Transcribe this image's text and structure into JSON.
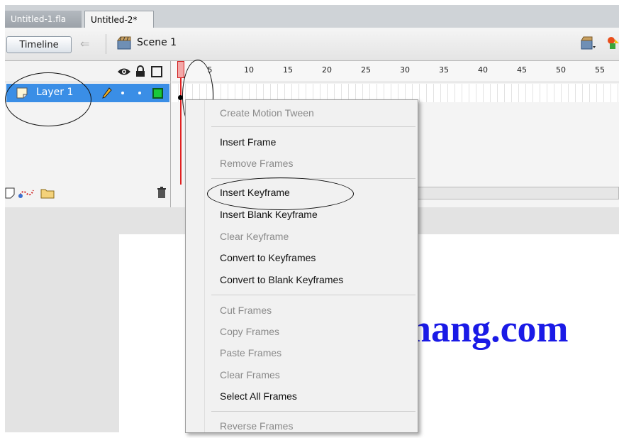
{
  "tabs": [
    {
      "label": "Untitled-1.fla",
      "active": false
    },
    {
      "label": "Untitled-2*",
      "active": true
    }
  ],
  "editbar": {
    "timeline_label": "Timeline",
    "scene_label": "Scene 1"
  },
  "layers": [
    {
      "name": "Layer 1",
      "selected": true
    }
  ],
  "ruler": {
    "ticks": [
      "5",
      "10",
      "15",
      "20",
      "25",
      "30",
      "35",
      "40",
      "45",
      "50",
      "55"
    ]
  },
  "context_menu": {
    "items": [
      {
        "label": "Create Motion Tween",
        "enabled": false
      },
      {
        "label": "Insert Frame",
        "enabled": true
      },
      {
        "label": "Remove Frames",
        "enabled": false
      },
      {
        "label": "Insert Keyframe",
        "enabled": true
      },
      {
        "label": "Insert Blank Keyframe",
        "enabled": true
      },
      {
        "label": "Clear Keyframe",
        "enabled": false
      },
      {
        "label": "Convert to Keyframes",
        "enabled": true
      },
      {
        "label": "Convert to Blank Keyframes",
        "enabled": true
      },
      {
        "label": "Cut Frames",
        "enabled": false
      },
      {
        "label": "Copy Frames",
        "enabled": false
      },
      {
        "label": "Paste Frames",
        "enabled": false
      },
      {
        "label": "Clear Frames",
        "enabled": false
      },
      {
        "label": "Select All Frames",
        "enabled": true
      },
      {
        "label": "Reverse Frames",
        "enabled": false
      }
    ]
  },
  "stage": {
    "text": "hang.com"
  },
  "colors": {
    "layer_selected": "#3a8ee6",
    "stage_text": "#1a1ae6",
    "playhead": "#e02020"
  },
  "icons": [
    "back-arrow-icon",
    "scene-icon",
    "edit-scene-icon",
    "edit-symbol-icon",
    "eye-icon",
    "lock-icon",
    "outline-icon",
    "layer-icon",
    "pencil-icon",
    "new-layer-icon",
    "motion-guide-icon",
    "new-folder-icon",
    "trash-icon"
  ]
}
